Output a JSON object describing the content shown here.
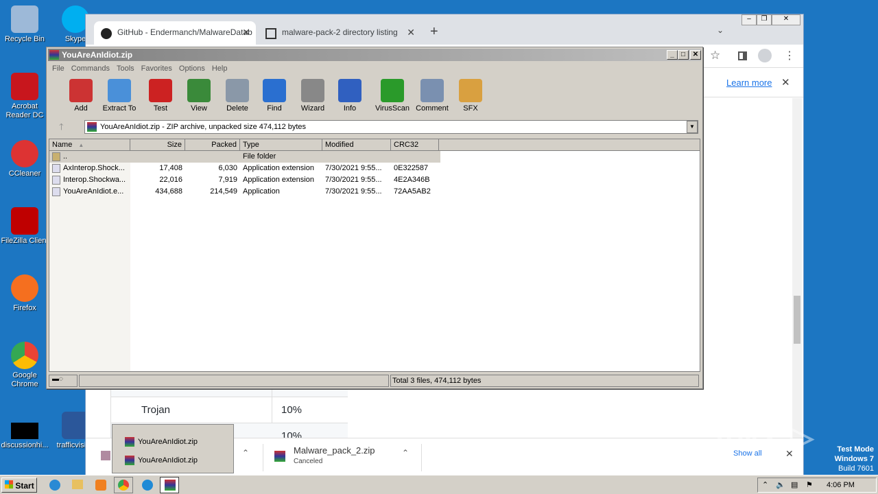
{
  "desktop": {
    "icons": [
      {
        "label": "Recycle Bin",
        "color": "#9db9d8"
      },
      {
        "label": "Acrobat Reader DC",
        "color": "#c8161d"
      },
      {
        "label": "CCleaner",
        "color": "#d33"
      },
      {
        "label": "FileZilla Client",
        "color": "#bf0000"
      },
      {
        "label": "Firefox",
        "color": "#f56f1f"
      },
      {
        "label": "Google Chrome",
        "color": "#34a853"
      },
      {
        "label": "discussionhi...",
        "color": "#000"
      }
    ],
    "partial": [
      "Skype",
      "trafficvisit..."
    ]
  },
  "chrome": {
    "tabs": [
      {
        "label": "GitHub - Endermanch/MalwareDatab",
        "icon": "github-icon"
      },
      {
        "label": "malware-pack-2 directory listing",
        "icon": "archive-icon"
      }
    ],
    "infobar": {
      "learn_more": "Learn more"
    },
    "page": {
      "rows": [
        {
          "name": "Trojan",
          "value": "10%"
        },
        {
          "name": "",
          "value": "10%"
        }
      ]
    },
    "downloads": {
      "popup": [
        "YouAreAnIdiot.zip",
        "YouAreAnIdiot.zip"
      ],
      "item": {
        "name": "Malware_pack_2.zip",
        "status": "Canceled"
      },
      "show_all": "Show all"
    }
  },
  "winrar": {
    "title": "YouAreAnIdiot.zip",
    "menu": [
      "File",
      "Commands",
      "Tools",
      "Favorites",
      "Options",
      "Help"
    ],
    "toolbar": [
      {
        "label": "Add",
        "color": "#c33"
      },
      {
        "label": "Extract To",
        "color": "#4a90d9"
      },
      {
        "label": "Test",
        "color": "#c22"
      },
      {
        "label": "View",
        "color": "#3a8a3a"
      },
      {
        "label": "Delete",
        "color": "#8a98a8"
      },
      {
        "label": "Find",
        "color": "#2a6fd0"
      },
      {
        "label": "Wizard",
        "color": "#888"
      },
      {
        "label": "Info",
        "color": "#3060c0"
      },
      {
        "label": "VirusScan",
        "color": "#2a9a2a"
      },
      {
        "label": "Comment",
        "color": "#7a90b0"
      },
      {
        "label": "SFX",
        "color": "#d9a040"
      }
    ],
    "address": "YouAreAnIdiot.zip - ZIP archive, unpacked size 474,112 bytes",
    "columns": [
      "Name",
      "Size",
      "Packed",
      "Type",
      "Modified",
      "CRC32"
    ],
    "files": [
      {
        "name": "..",
        "size": "",
        "packed": "",
        "type": "File folder",
        "modified": "",
        "crc": ""
      },
      {
        "name": "AxInterop.Shock...",
        "size": "17,408",
        "packed": "6,030",
        "type": "Application extension",
        "modified": "7/30/2021 9:55...",
        "crc": "0E322587"
      },
      {
        "name": "Interop.Shockwa...",
        "size": "22,016",
        "packed": "7,919",
        "type": "Application extension",
        "modified": "7/30/2021 9:55...",
        "crc": "4E2A346B"
      },
      {
        "name": "YouAreAnIdiot.e...",
        "size": "434,688",
        "packed": "214,549",
        "type": "Application",
        "modified": "7/30/2021 9:55...",
        "crc": "72AA5AB2"
      }
    ],
    "status": "Total 3 files, 474,112 bytes"
  },
  "taskbar": {
    "start": "Start",
    "time": "4:06 PM"
  },
  "watermark": {
    "logo": "ANY.RUN",
    "line1": "Test Mode",
    "line2": "Windows 7",
    "line3": "Build 7601"
  }
}
